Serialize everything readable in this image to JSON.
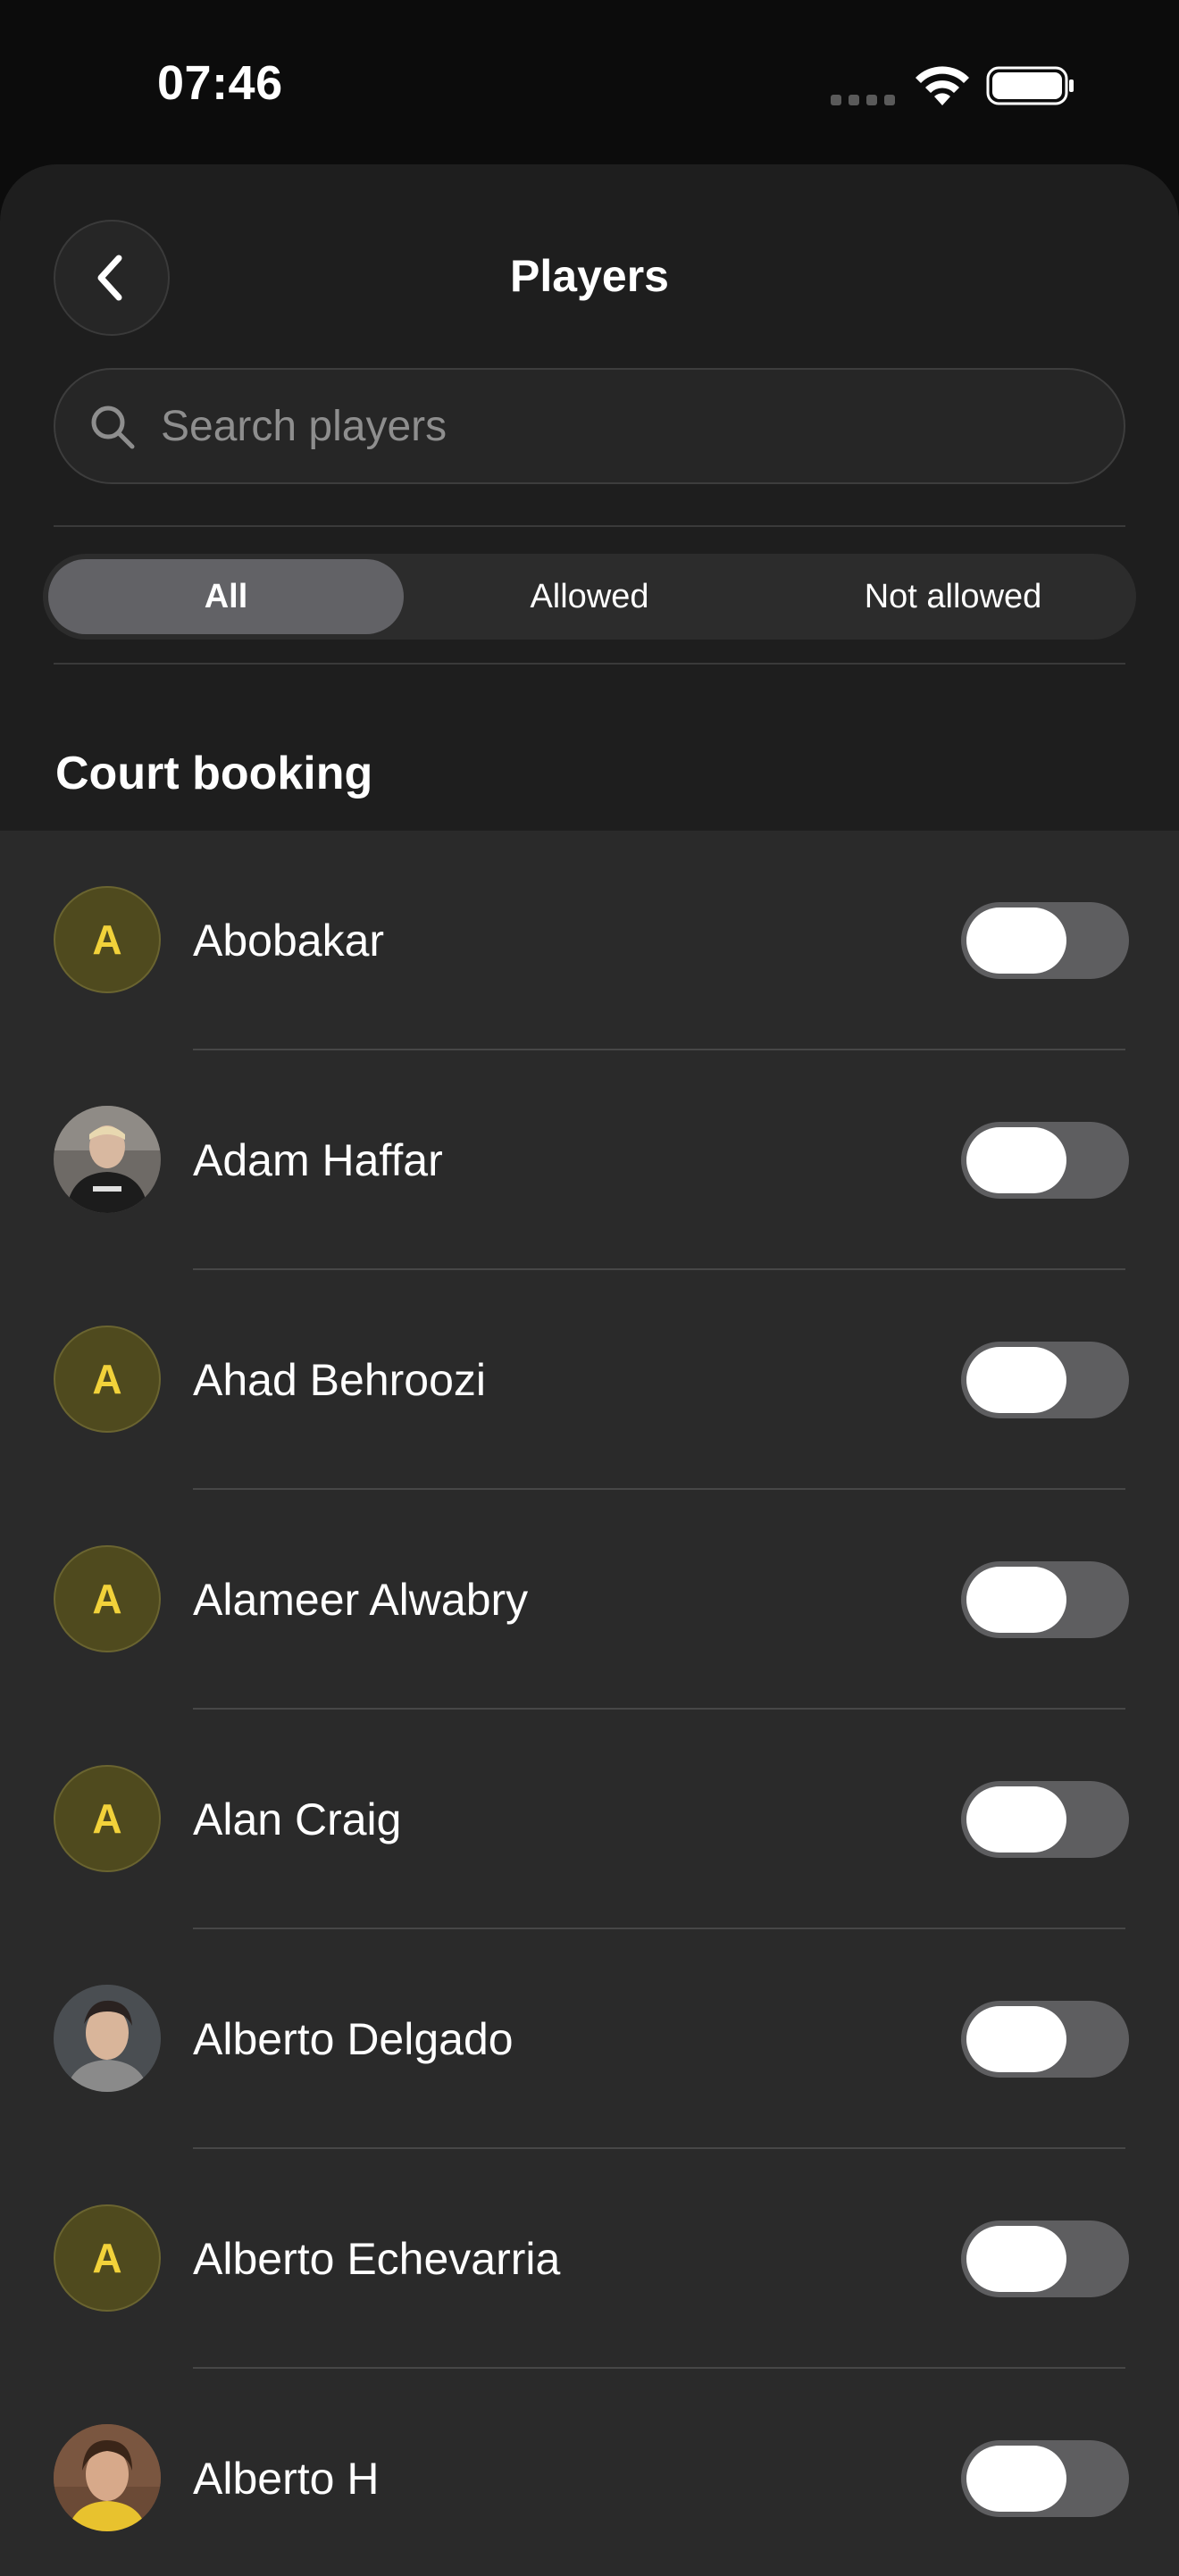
{
  "status_bar": {
    "time": "07:46"
  },
  "header": {
    "title": "Players"
  },
  "search": {
    "placeholder": "Search players",
    "value": ""
  },
  "filter": {
    "options": [
      {
        "label": "All",
        "selected": true
      },
      {
        "label": "Allowed",
        "selected": false
      },
      {
        "label": "Not allowed",
        "selected": false
      }
    ]
  },
  "section": {
    "title": "Court booking"
  },
  "players": [
    {
      "name": "Abobakar",
      "avatar_letter": "A",
      "avatar_type": "letter",
      "allowed": false
    },
    {
      "name": "Adam Haffar",
      "avatar_letter": "",
      "avatar_type": "photo",
      "allowed": false
    },
    {
      "name": "Ahad Behroozi",
      "avatar_letter": "A",
      "avatar_type": "letter",
      "allowed": false
    },
    {
      "name": "Alameer Alwabry",
      "avatar_letter": "A",
      "avatar_type": "letter",
      "allowed": false
    },
    {
      "name": "Alan Craig",
      "avatar_letter": "A",
      "avatar_type": "letter",
      "allowed": false
    },
    {
      "name": "Alberto Delgado",
      "avatar_letter": "",
      "avatar_type": "photo",
      "allowed": false
    },
    {
      "name": "Alberto Echevarria",
      "avatar_letter": "A",
      "avatar_type": "letter",
      "allowed": false
    },
    {
      "name": "Alberto H",
      "avatar_letter": "",
      "avatar_type": "photo",
      "allowed": false
    }
  ],
  "colors": {
    "background": "#0c0c0c",
    "sheet": "#1e1e1e",
    "list": "#2a2a2a",
    "avatar_letter_bg": "#4f4a1e",
    "avatar_letter_fg": "#f2d23a",
    "toggle_off": "#5e5e60",
    "segment_active": "#626266"
  }
}
